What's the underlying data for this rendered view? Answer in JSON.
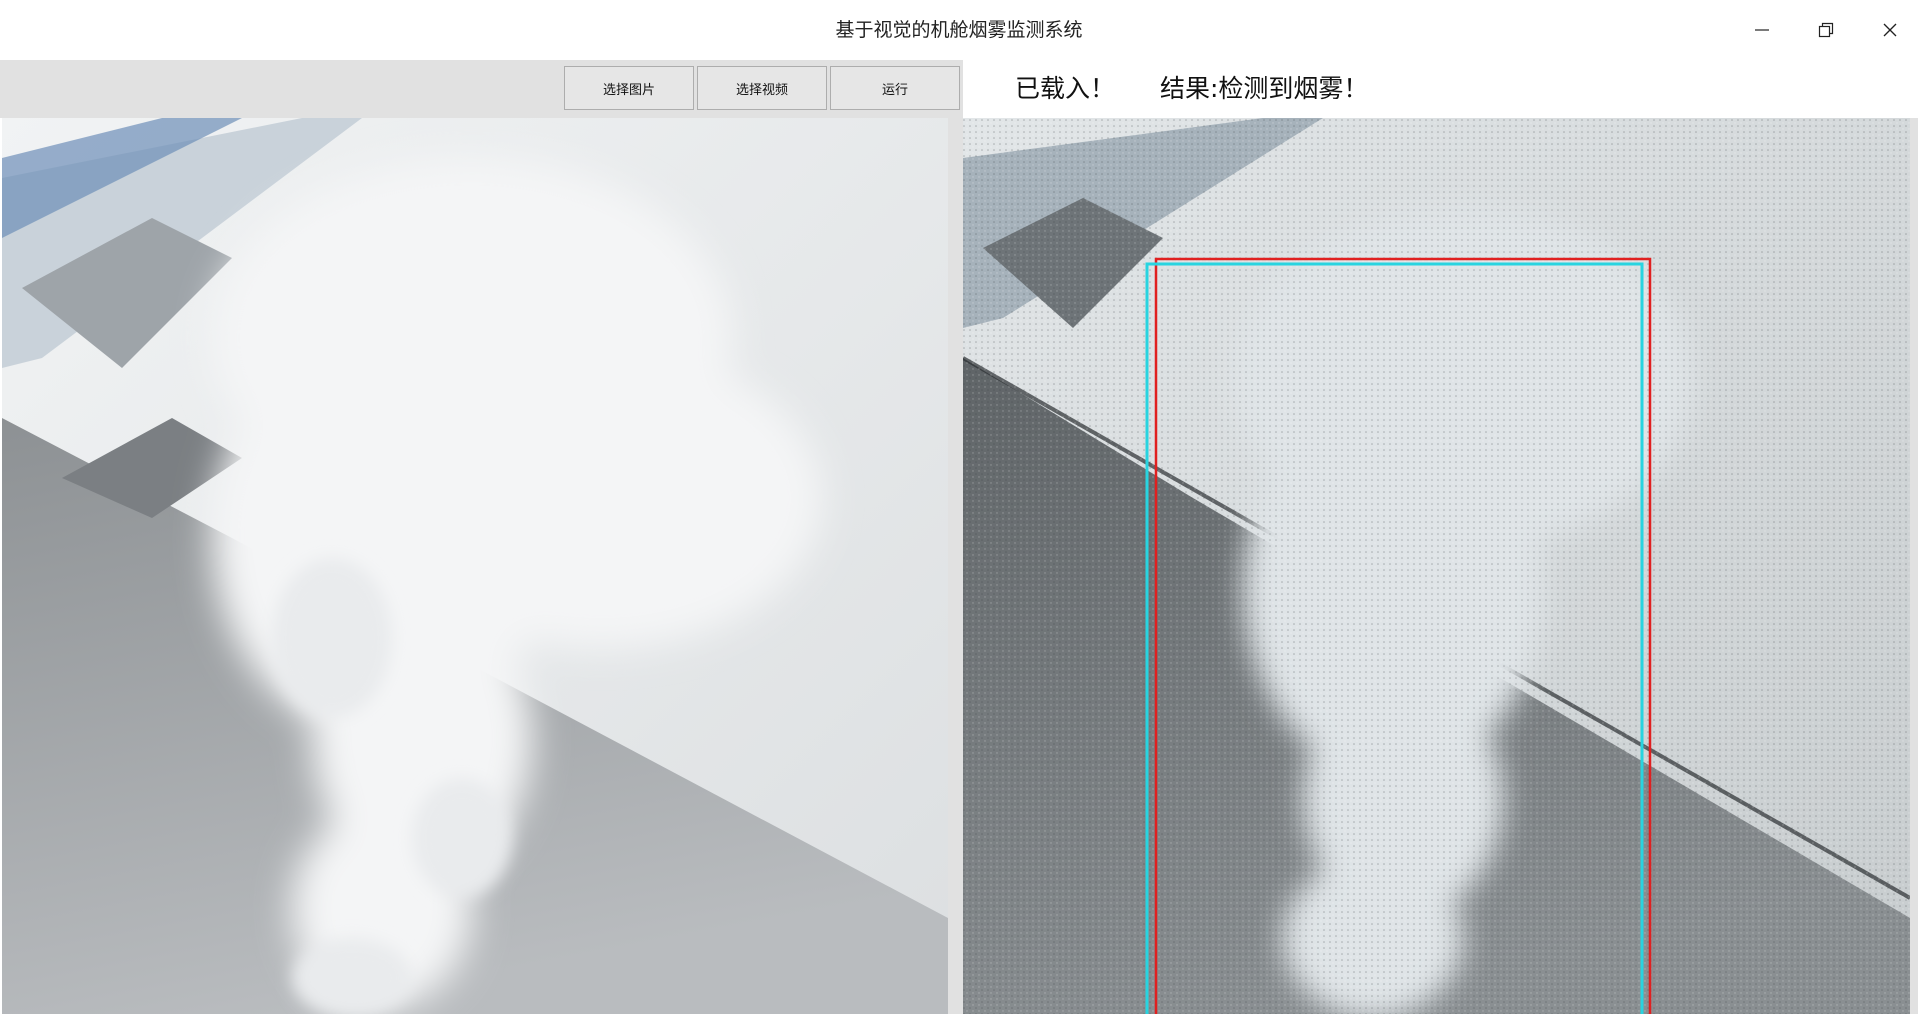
{
  "window": {
    "title": "基于视觉的机舱烟雾监测系统",
    "controls": [
      "minimize",
      "maximize",
      "close"
    ]
  },
  "toolbar": {
    "buttons": [
      "选择图片",
      "选择视频",
      "运行"
    ]
  },
  "status": {
    "loaded_text": "已载入！",
    "result_text": "结果:检测到烟雾！"
  },
  "images": {
    "left": {
      "content": "smoke-photo"
    },
    "right": {
      "content": "smoke-photo-processed",
      "detections": [
        "red-box",
        "cyan-box"
      ]
    }
  },
  "colors": {
    "toolbar_bg": "#e1e1e1",
    "button_bg": "#e6e6e6",
    "detection_red": "#e02020",
    "detection_cyan": "#28d4e0"
  }
}
